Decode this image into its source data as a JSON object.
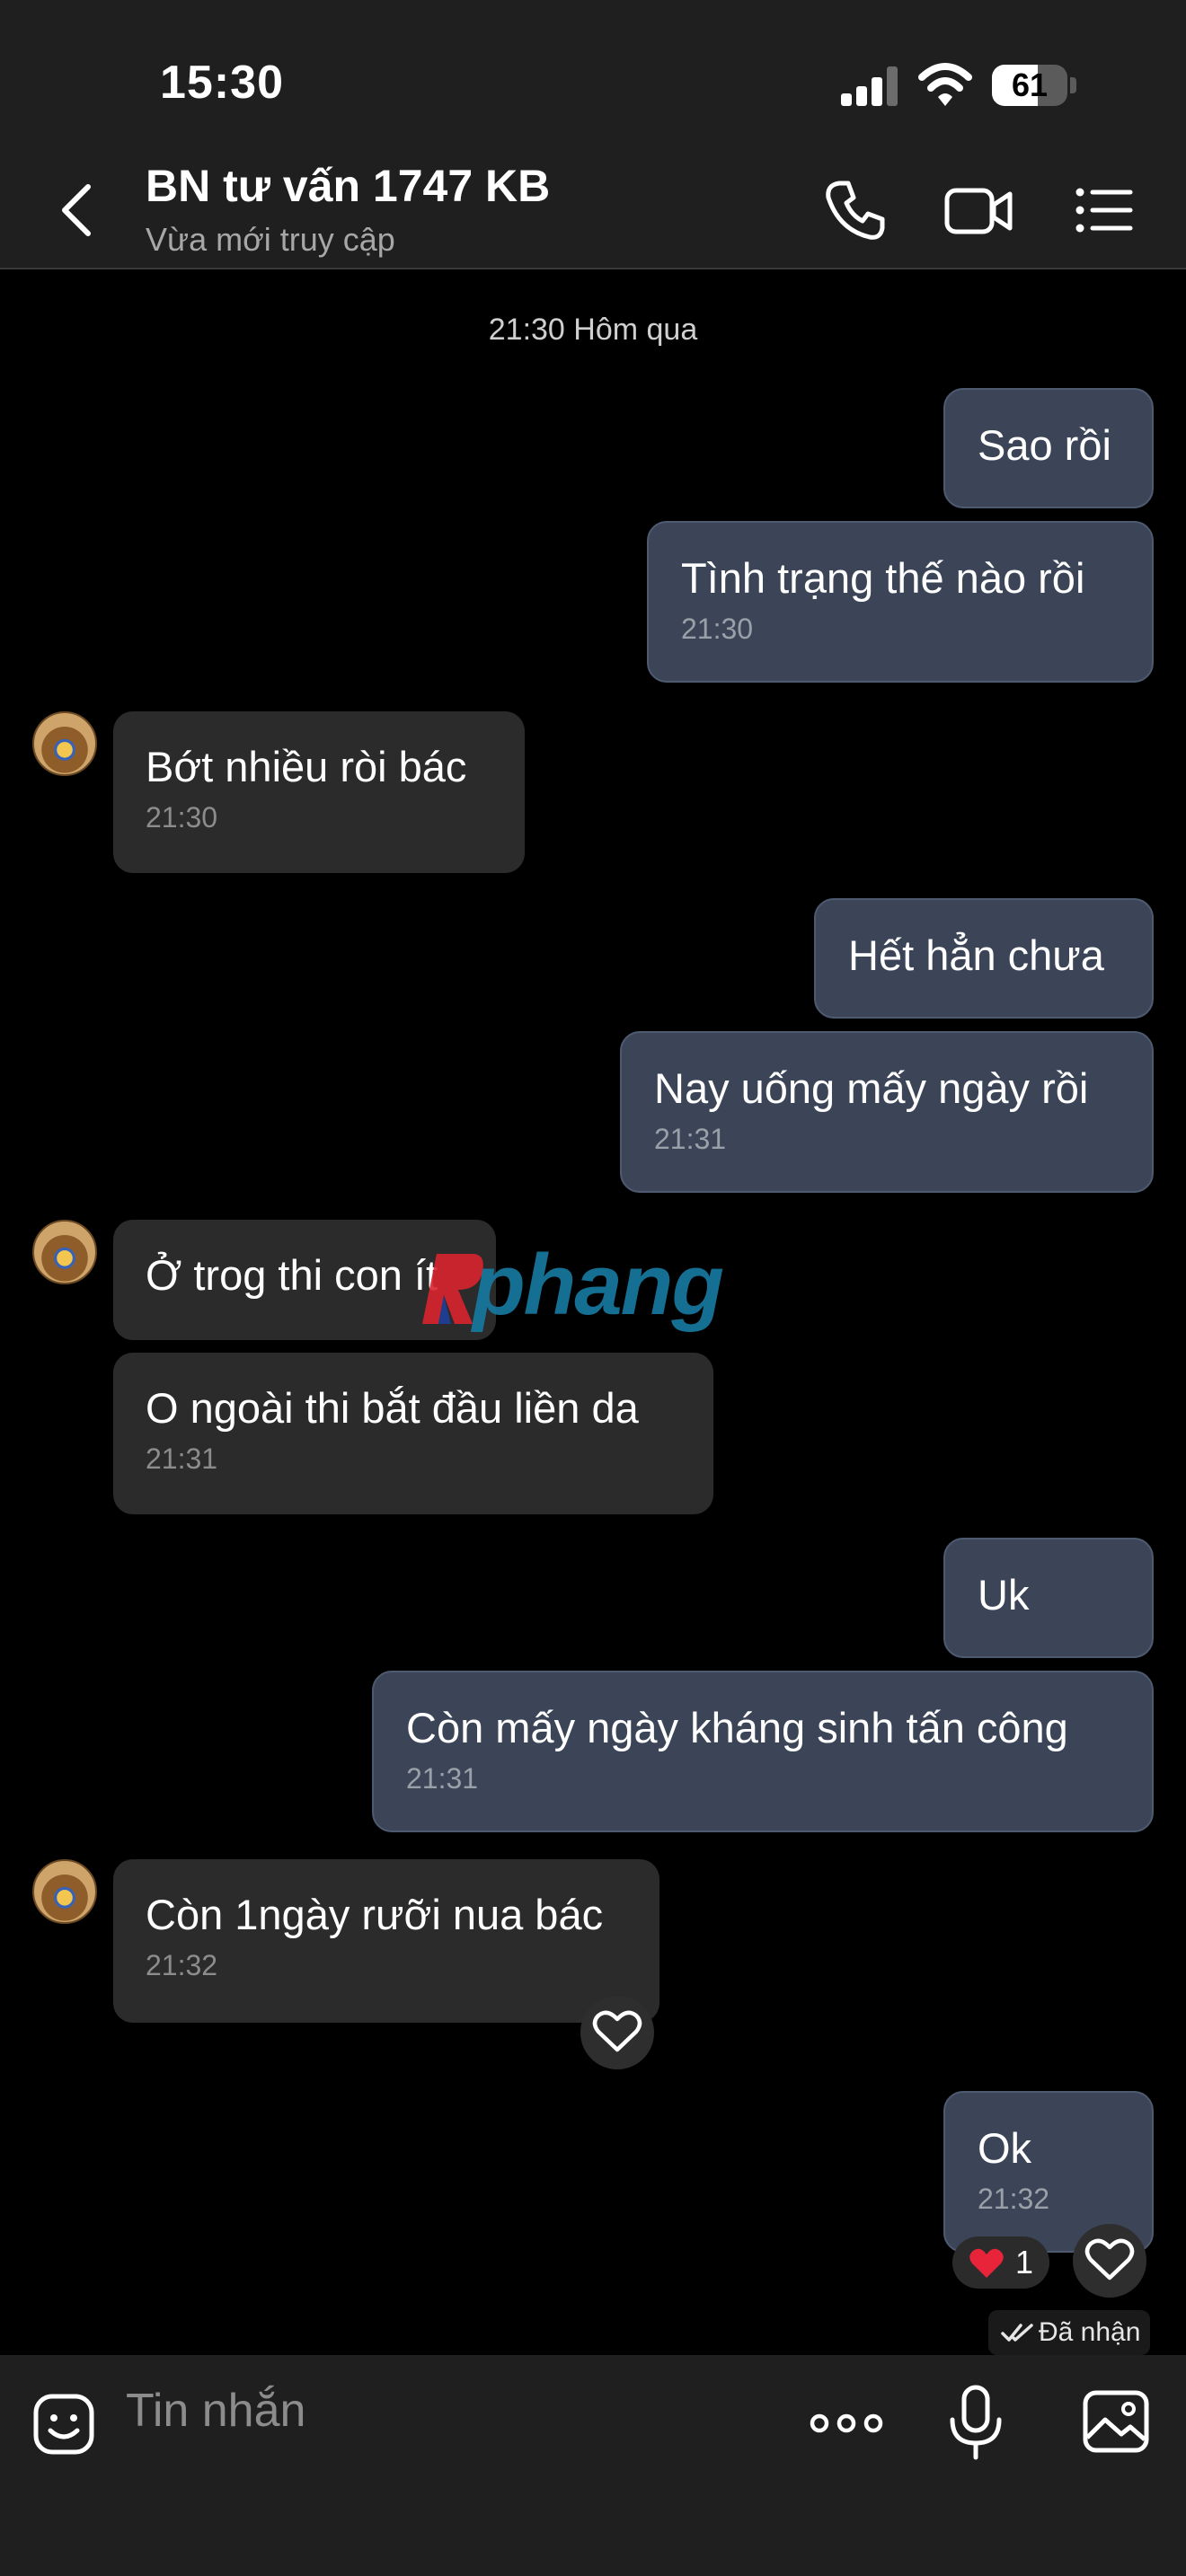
{
  "status_bar": {
    "time": "15:30",
    "battery": "61",
    "battery_level": 0.61
  },
  "header": {
    "back_icon": "chevron-left-icon",
    "title": "BN tư vấn 1747 KB",
    "subtitle": "Vừa mới truy cập",
    "actions": [
      "phone-icon",
      "video-icon",
      "menu-list-icon"
    ]
  },
  "conversation": {
    "date_separator": "21:30 Hôm qua",
    "messages": [
      {
        "from": "me",
        "text": "Sao rồi",
        "time": ""
      },
      {
        "from": "me",
        "text": "Tình trạng thế nào rồi",
        "time": "21:30"
      },
      {
        "from": "them",
        "text": "Bớt nhiều ròi bác",
        "time": "21:30"
      },
      {
        "from": "me",
        "text": "Hết hẳn chưa",
        "time": ""
      },
      {
        "from": "me",
        "text": "Nay uống mấy ngày rồi",
        "time": "21:31"
      },
      {
        "from": "them",
        "text": "Ở trog thi con ít",
        "time": ""
      },
      {
        "from": "them",
        "text": "O ngoài thi bắt đầu liền da",
        "time": "21:31"
      },
      {
        "from": "me",
        "text": "Uk",
        "time": ""
      },
      {
        "from": "me",
        "text": "Còn mấy ngày kháng sinh tấn công",
        "time": "21:31"
      },
      {
        "from": "them",
        "text": "Còn 1ngày rưỡi nua bác",
        "time": "21:32"
      },
      {
        "from": "me",
        "text": "Ok",
        "time": "21:32"
      }
    ],
    "reaction": {
      "icon": "red-heart-icon",
      "count": "1"
    },
    "delivery_status": "Đã nhận"
  },
  "watermark": {
    "text": "phang"
  },
  "composer": {
    "placeholder": "Tin nhắn",
    "icons": [
      "sticker-icon",
      "more-icon",
      "microphone-icon",
      "image-icon"
    ]
  },
  "colors": {
    "outgoing_bubble": "#3b4557",
    "incoming_bubble": "#2b2b2b",
    "background": "#000000",
    "header": "#1f1f1f"
  }
}
